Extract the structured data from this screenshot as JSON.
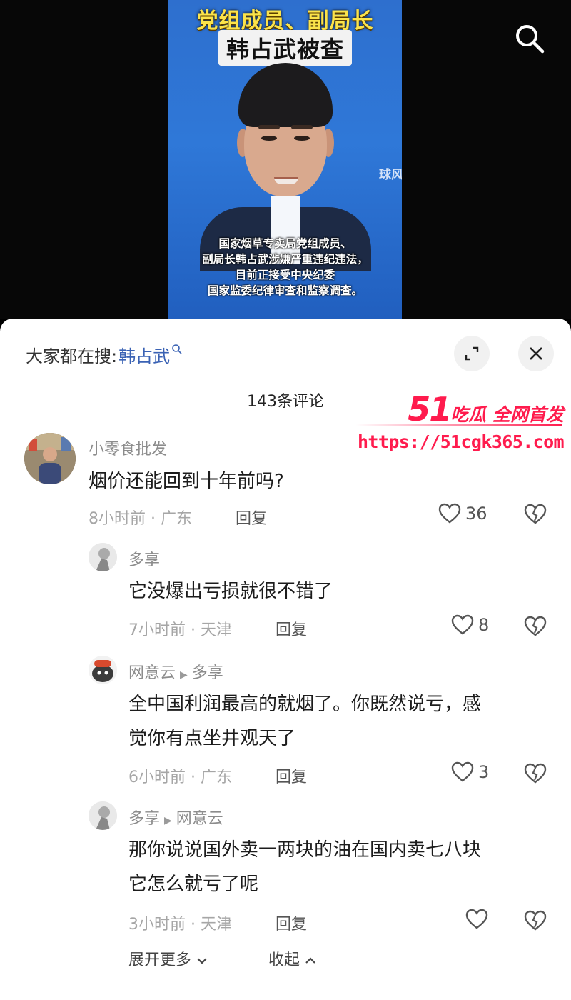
{
  "video": {
    "headline1": "党组成员、副局长",
    "headline2": "韩占武被查",
    "watermark": "球风",
    "caption_lines": [
      "国家烟草专卖局党组成员、",
      "副局长韩占武涉嫌严重违纪违法，",
      "目前正接受中央纪委",
      "国家监委纪律审查和监察调查。"
    ]
  },
  "header": {
    "search_prefix": "大家都在搜:",
    "search_term": "韩占武",
    "comment_count": "143条评论"
  },
  "promo": {
    "title_big": "51",
    "title_rest": "吃瓜 全网首发",
    "url": "https://51cgk365.com"
  },
  "comments": [
    {
      "user": "小零食批发",
      "text": "烟价还能回到十年前吗?",
      "time": "8小时前 · 广东",
      "reply": "回复",
      "likes": "36"
    },
    {
      "user": "多享",
      "text": "它没爆出亏损就很不错了",
      "time": "7小时前 · 天津",
      "reply": "回复",
      "likes": "8"
    },
    {
      "user": "网意云",
      "reply_to": "多享",
      "text_lines": [
        "全中国利润最高的就烟了。你既然说亏，感",
        "觉你有点坐井观天了"
      ],
      "time": "6小时前 · 广东",
      "reply": "回复",
      "likes": "3"
    },
    {
      "user": "多享",
      "reply_to": "网意云",
      "text_lines": [
        "那你说说国外卖一两块的油在国内卖七八块",
        "它怎么就亏了呢"
      ],
      "time": "3小时前 · 天津",
      "reply": "回复",
      "likes": ""
    }
  ],
  "footer": {
    "expand_more": "展开更多",
    "collapse": "收起"
  },
  "colors": {
    "accent_link": "#3a62b4",
    "promo_red": "#ff1b4d"
  }
}
